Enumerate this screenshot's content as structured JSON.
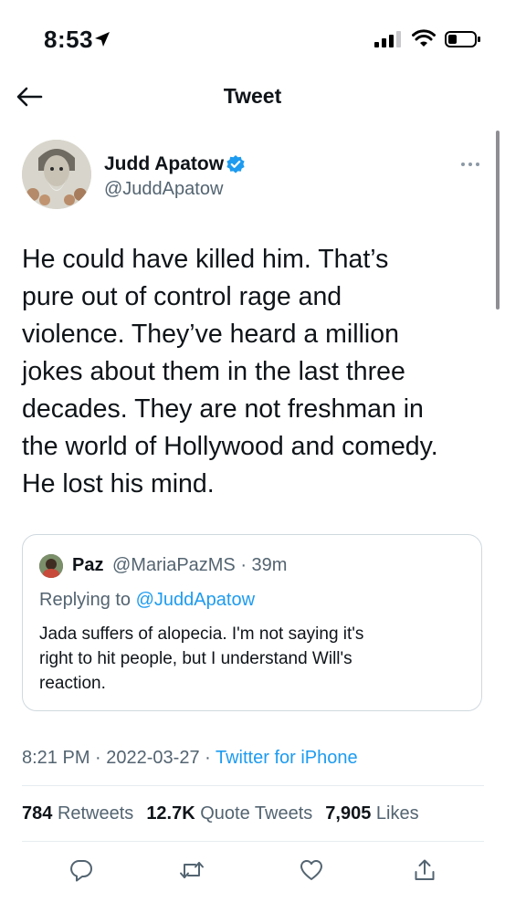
{
  "status_bar": {
    "time": "8:53"
  },
  "header": {
    "title": "Tweet"
  },
  "tweet": {
    "author_name": "Judd Apatow",
    "author_handle": "@JuddApatow",
    "text": "He could have killed him.  That’s\npure out of control rage and\nviolence.    They’ve heard a million\njokes about them in the last three\ndecades.  They are not freshman in\nthe world of Hollywood and comedy.\nHe lost his mind.",
    "time": "8:21 PM",
    "date": "2022-03-27",
    "source": "Twitter for iPhone",
    "retweets": "784",
    "retweets_label": "Retweets",
    "quote_tweets": "12.7K",
    "quote_tweets_label": "Quote Tweets",
    "likes": "7,905",
    "likes_label": "Likes"
  },
  "quoted": {
    "name": "Paz",
    "handle_time": "@MariaPazMS · 39m",
    "replying_to_label": "Replying to",
    "replying_to_handle": "@JuddApatow",
    "text": "Jada suffers of alopecia. I'm not saying it's\nright to hit people,  but I understand Will's\nreaction."
  },
  "icons": {
    "back": "arrow-left-icon",
    "verified": "verified-badge-icon",
    "more": "more-horizontal-icon",
    "reply": "reply-icon",
    "retweet": "retweet-icon",
    "like": "heart-icon",
    "share": "share-icon"
  },
  "colors": {
    "accent": "#1d9bf0",
    "secondary_text": "#536471",
    "text": "#0f1419"
  }
}
